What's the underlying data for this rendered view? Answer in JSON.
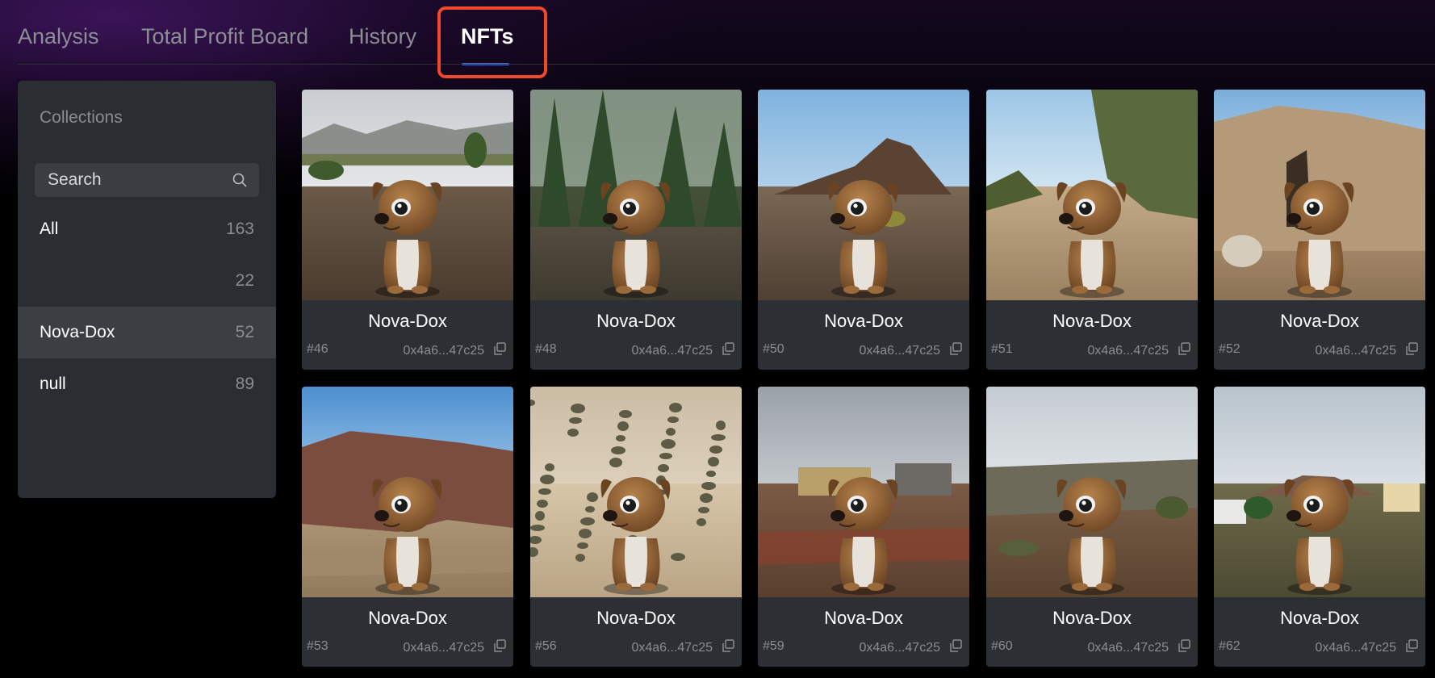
{
  "tabs": [
    {
      "label": "Analysis"
    },
    {
      "label": "Total Profit Board"
    },
    {
      "label": "History"
    },
    {
      "label": "NFTs",
      "active": true
    }
  ],
  "sidebar": {
    "title": "Collections",
    "search_placeholder": "Search",
    "categories": [
      {
        "label": "All",
        "count": "163"
      },
      {
        "label": "",
        "count": "22"
      },
      {
        "label": "Nova-Dox",
        "count": "52",
        "selected": true
      },
      {
        "label": "null",
        "count": "89"
      }
    ]
  },
  "nfts": [
    {
      "name": "Nova-Dox",
      "id": "#46",
      "address": "0x4a6...47c25",
      "scene": "hills"
    },
    {
      "name": "Nova-Dox",
      "id": "#48",
      "address": "0x4a6...47c25",
      "scene": "forest"
    },
    {
      "name": "Nova-Dox",
      "id": "#50",
      "address": "0x4a6...47c25",
      "scene": "volcano"
    },
    {
      "name": "Nova-Dox",
      "id": "#51",
      "address": "0x4a6...47c25",
      "scene": "bush"
    },
    {
      "name": "Nova-Dox",
      "id": "#52",
      "address": "0x4a6...47c25",
      "scene": "rocks"
    },
    {
      "name": "Nova-Dox",
      "id": "#53",
      "address": "0x4a6...47c25",
      "scene": "redrock"
    },
    {
      "name": "Nova-Dox",
      "id": "#56",
      "address": "0x4a6...47c25",
      "scene": "dunes"
    },
    {
      "name": "Nova-Dox",
      "id": "#59",
      "address": "0x4a6...47c25",
      "scene": "ruins"
    },
    {
      "name": "Nova-Dox",
      "id": "#60",
      "address": "0x4a6...47c25",
      "scene": "scrub"
    },
    {
      "name": "Nova-Dox",
      "id": "#62",
      "address": "0x4a6...47c25",
      "scene": "village"
    }
  ],
  "colors": {
    "accent": "#3d6df2",
    "highlight": "#f0482c"
  }
}
